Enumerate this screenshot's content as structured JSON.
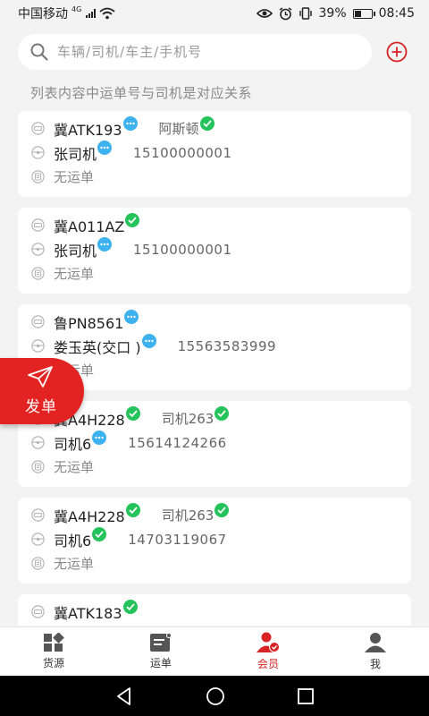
{
  "status_bar": {
    "carrier": "中国移动",
    "network": "4G",
    "battery": "39%",
    "battery_level": 0.39,
    "time": "08:45"
  },
  "search": {
    "placeholder": "车辆/司机/车主/手机号"
  },
  "hint": "列表内容中运单号与司机是对应关系",
  "vehicles": [
    {
      "plate": "冀ATK193",
      "plate_status": "pending",
      "owner": "阿斯顿",
      "owner_status": "verified",
      "driver": "张司机",
      "driver_status": "pending",
      "phone": "15100000001",
      "waybill": "无运单"
    },
    {
      "plate": "冀A011AZ",
      "plate_status": "verified",
      "owner": "",
      "owner_status": "",
      "driver": "张司机",
      "driver_status": "pending",
      "phone": "15100000001",
      "waybill": "无运单"
    },
    {
      "plate": "鲁PN8561",
      "plate_status": "pending",
      "owner": "",
      "owner_status": "",
      "driver": "娄玉英(交口 )",
      "driver_status": "pending",
      "phone": "15563583999",
      "waybill": "无运单"
    },
    {
      "plate": "冀A4H228",
      "plate_status": "verified",
      "owner": "司机263",
      "owner_status": "verified",
      "driver": "司机6",
      "driver_status": "pending",
      "phone": "15614124266",
      "waybill": "无运单"
    },
    {
      "plate": "冀A4H228",
      "plate_status": "verified",
      "owner": "司机263",
      "owner_status": "verified",
      "driver": "司机6",
      "driver_status": "verified",
      "phone": "14703119067",
      "waybill": "无运单"
    },
    {
      "plate": "冀ATK183",
      "plate_status": "verified",
      "owner": "",
      "owner_status": "",
      "driver": "",
      "driver_status": "",
      "phone": "",
      "waybill": ""
    }
  ],
  "fab": {
    "label": "发单"
  },
  "tabs": [
    {
      "label": "货源",
      "icon": "cargo-icon",
      "active": false
    },
    {
      "label": "运单",
      "icon": "waybill-icon",
      "active": false
    },
    {
      "label": "会员",
      "icon": "member-icon",
      "active": true
    },
    {
      "label": "我",
      "icon": "profile-icon",
      "active": false
    }
  ],
  "colors": {
    "accent": "#d72323",
    "fab": "#e32222",
    "verified": "#24c35b",
    "pending": "#3db2ee",
    "background": "#f3f3f3"
  }
}
